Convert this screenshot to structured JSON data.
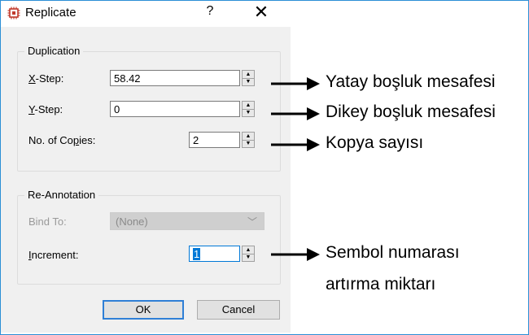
{
  "window": {
    "title": "Replicate",
    "icon": "chip-icon",
    "help_label": "?",
    "close_label": "✕"
  },
  "duplication": {
    "legend": "Duplication",
    "x_step": {
      "label_key": "X",
      "label_rest": "-Step:",
      "value": "58.42"
    },
    "y_step": {
      "label_key": "Y",
      "label_rest": "-Step:",
      "value": "0"
    },
    "copies": {
      "label_pre": "No. of Co",
      "label_key": "p",
      "label_post": "ies:",
      "value": "2"
    }
  },
  "reannotation": {
    "legend": "Re-Annotation",
    "bind_to": {
      "label": "Bind To:",
      "value": "(None)"
    },
    "increment": {
      "label_key": "I",
      "label_rest": "ncrement:",
      "value": "1"
    }
  },
  "buttons": {
    "ok": "OK",
    "cancel": "Cancel"
  },
  "annotations": {
    "x_step": "Yatay boşluk mesafesi",
    "y_step": "Dikey boşluk mesafesi",
    "copies": "Kopya sayısı",
    "increment_line1": "Sembol numarası",
    "increment_line2": "artırma miktarı"
  },
  "colors": {
    "frame": "#2b8fd6",
    "selection": "#0078d7",
    "default_button": "#2f7fd6"
  }
}
